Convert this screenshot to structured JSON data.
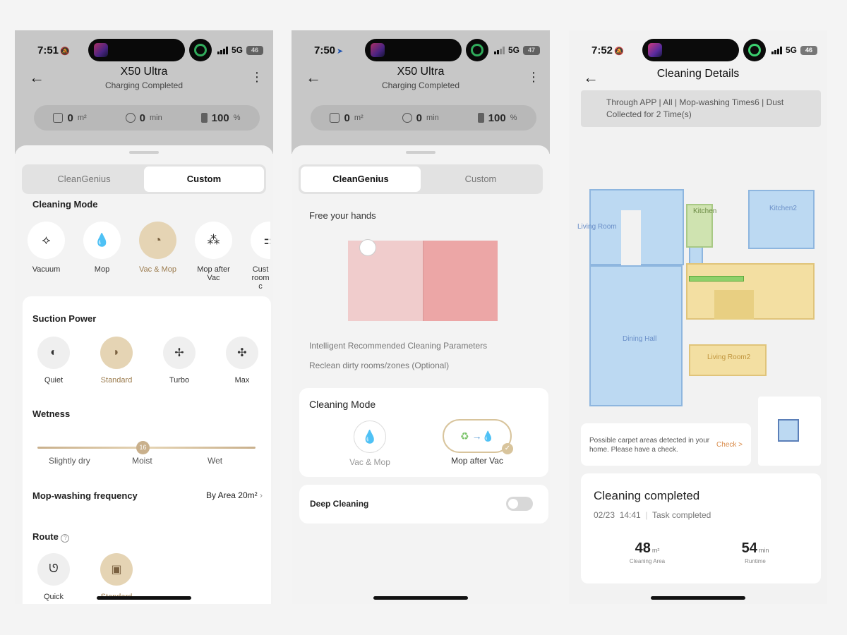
{
  "phone1": {
    "status": {
      "time": "7:51",
      "network": "5G",
      "battery": "46"
    },
    "title": "X50 Ultra",
    "subtitle": "Charging Completed",
    "stats": [
      {
        "value": "0",
        "unit": "m²"
      },
      {
        "value": "0",
        "unit": "min"
      },
      {
        "value": "100",
        "unit": "%"
      }
    ],
    "tabs": [
      "CleanGenius",
      "Custom"
    ],
    "selected_tab": "Custom",
    "cleaning_mode_heading": "Cleaning Mode",
    "modes": [
      "Vacuum",
      "Mop",
      "Vac & Mop",
      "Mop after Vac",
      "Cust room c"
    ],
    "selected_mode": "Vac & Mop",
    "suction_heading": "Suction Power",
    "suction": [
      "Quiet",
      "Standard",
      "Turbo",
      "Max"
    ],
    "selected_suction": "Standard",
    "wetness_heading": "Wetness",
    "wetness_value": "16",
    "wetness_levels": [
      "Slightly dry",
      "Moist",
      "Wet"
    ],
    "mop_freq_label": "Mop-washing frequency",
    "mop_freq_value": "By Area 20m²",
    "route_heading": "Route",
    "routes": [
      "Quick",
      "Standard"
    ],
    "selected_route": "Standard"
  },
  "phone2": {
    "status": {
      "time": "7:50",
      "network": "5G",
      "battery": "47"
    },
    "title": "X50 Ultra",
    "subtitle": "Charging Completed",
    "stats": [
      {
        "value": "0",
        "unit": "m²"
      },
      {
        "value": "0",
        "unit": "min"
      },
      {
        "value": "100",
        "unit": "%"
      }
    ],
    "tabs": [
      "CleanGenius",
      "Custom"
    ],
    "selected_tab": "CleanGenius",
    "free_hands": "Free your hands",
    "recommended": "Intelligent Recommended Cleaning Parameters",
    "reclean": "Reclean dirty rooms/zones (Optional)",
    "cleaning_mode_heading": "Cleaning Mode",
    "modes": [
      "Vac & Mop",
      "Mop after Vac"
    ],
    "selected_mode": "Mop after Vac",
    "deep_cleaning": "Deep Cleaning",
    "deep_cleaning_on": false
  },
  "phone3": {
    "status": {
      "time": "7:52",
      "network": "5G",
      "battery": "46"
    },
    "title": "Cleaning Details",
    "banner": "Through APP | All | Mop-washing Times6 | Dust Collected for 2 Time(s)",
    "rooms": [
      "Living Room",
      "Kitchen",
      "Kitchen2",
      "Dining Hall",
      "Living Room2"
    ],
    "carpet_msg": "Possible carpet areas detected in your home. Please have a check.",
    "check_link": "Check >",
    "completed_title": "Cleaning completed",
    "date": "02/23",
    "time_done": "14:41",
    "task_status": "Task completed",
    "area_value": "48",
    "area_unit": "m²",
    "area_label": "Cleaning Area",
    "runtime_value": "54",
    "runtime_unit": "min",
    "runtime_label": "Runtime"
  },
  "colors": {
    "accent": "#e5d4b4",
    "accent_text": "#9b7b4d",
    "map_blue": "#bcd9f2",
    "map_green": "#cfe3b0",
    "map_yellow": "#f3dfa2"
  }
}
